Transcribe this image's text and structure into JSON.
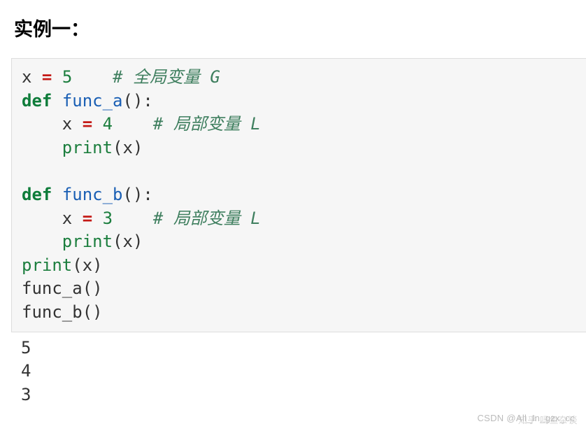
{
  "heading": "实例一：",
  "code": {
    "lines": [
      {
        "tokens": [
          {
            "t": "x ",
            "c": ""
          },
          {
            "t": "=",
            "c": "tok-assign"
          },
          {
            "t": " ",
            "c": ""
          },
          {
            "t": "5",
            "c": "tok-num"
          },
          {
            "t": "    ",
            "c": ""
          },
          {
            "t": "# 全局变量 G",
            "c": "tok-comment"
          }
        ]
      },
      {
        "tokens": [
          {
            "t": "def",
            "c": "tok-keyword"
          },
          {
            "t": " ",
            "c": ""
          },
          {
            "t": "func_a",
            "c": "tok-def"
          },
          {
            "t": "()",
            "c": "tok-punct"
          },
          {
            "t": ":",
            "c": "tok-punct"
          }
        ]
      },
      {
        "tokens": [
          {
            "t": "    x ",
            "c": ""
          },
          {
            "t": "=",
            "c": "tok-assign"
          },
          {
            "t": " ",
            "c": ""
          },
          {
            "t": "4",
            "c": "tok-num"
          },
          {
            "t": "    ",
            "c": ""
          },
          {
            "t": "# 局部变量 L",
            "c": "tok-comment"
          }
        ]
      },
      {
        "tokens": [
          {
            "t": "    ",
            "c": ""
          },
          {
            "t": "print",
            "c": "tok-builtin"
          },
          {
            "t": "(x)",
            "c": "tok-punct"
          }
        ]
      },
      {
        "tokens": []
      },
      {
        "tokens": [
          {
            "t": "def",
            "c": "tok-keyword"
          },
          {
            "t": " ",
            "c": ""
          },
          {
            "t": "func_b",
            "c": "tok-def"
          },
          {
            "t": "()",
            "c": "tok-punct"
          },
          {
            "t": ":",
            "c": "tok-punct"
          }
        ]
      },
      {
        "tokens": [
          {
            "t": "    x ",
            "c": ""
          },
          {
            "t": "=",
            "c": "tok-assign"
          },
          {
            "t": " ",
            "c": ""
          },
          {
            "t": "3",
            "c": "tok-num"
          },
          {
            "t": "    ",
            "c": ""
          },
          {
            "t": "# 局部变量 L",
            "c": "tok-comment"
          }
        ]
      },
      {
        "tokens": [
          {
            "t": "    ",
            "c": ""
          },
          {
            "t": "print",
            "c": "tok-builtin"
          },
          {
            "t": "(x)",
            "c": "tok-punct"
          }
        ]
      },
      {
        "tokens": [
          {
            "t": "print",
            "c": "tok-builtin"
          },
          {
            "t": "(x)",
            "c": "tok-punct"
          }
        ]
      },
      {
        "tokens": [
          {
            "t": "func_a()",
            "c": ""
          }
        ]
      },
      {
        "tokens": [
          {
            "t": "func_b()",
            "c": ""
          }
        ]
      }
    ]
  },
  "output": {
    "lines": [
      "5",
      "4",
      "3"
    ]
  },
  "watermark_a": "知乎",
  "watermark_b": "CSDN @All_In_gzx_cc",
  "watermark_c": "吗鱼杂谈"
}
